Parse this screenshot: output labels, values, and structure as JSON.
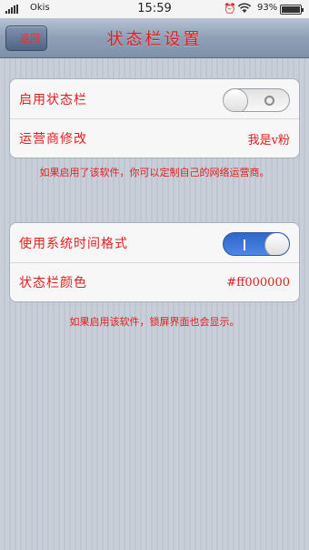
{
  "status_bar": {
    "carrier": "Okis",
    "time": "15:59",
    "battery": "93%"
  },
  "nav": {
    "back_label": "返回",
    "title": "状态栏设置"
  },
  "group1": {
    "enable_status_bar": {
      "label": "启用状态栏",
      "toggle_on": false
    },
    "carrier_edit": {
      "label": "运营商修改",
      "value": "我是v粉"
    }
  },
  "note1": "如果启用了该软件，你可以定制自己的网络运营商。",
  "group2": {
    "system_time_format": {
      "label": "使用系统时间格式",
      "toggle_on": true
    },
    "status_bar_color": {
      "label": "状态栏颜色",
      "value": "#ff000000"
    }
  },
  "note2": "如果启用该软件，锁屏界面也会显示。",
  "colors": {
    "accent_text": "#e02020",
    "toggle_on": "#3a72d6"
  }
}
